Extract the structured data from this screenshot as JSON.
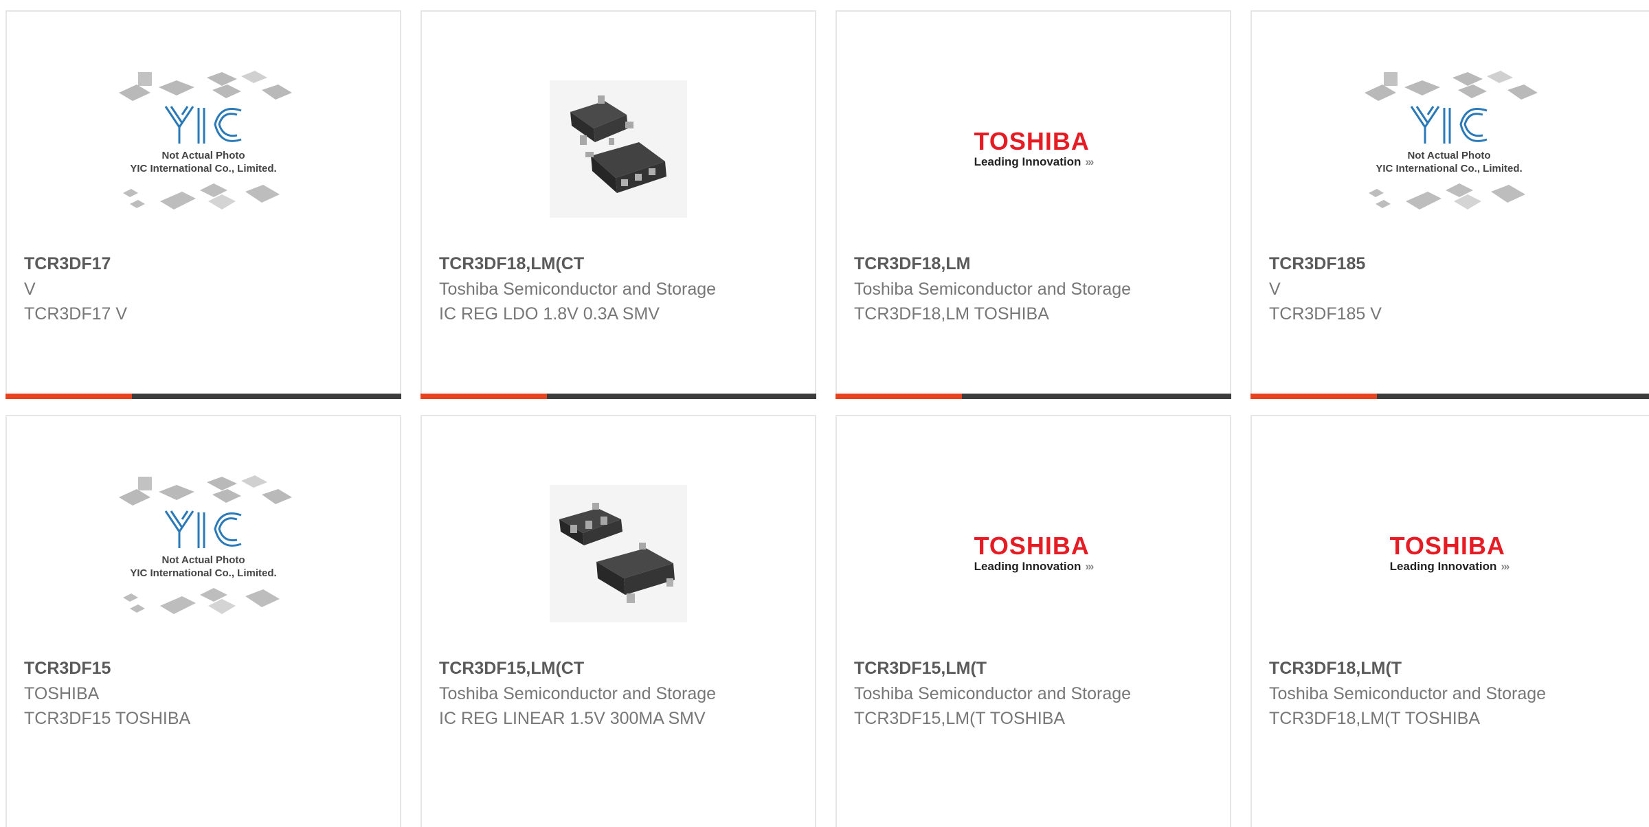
{
  "placeholder": {
    "line1": "Not Actual Photo",
    "line2": "YIC International Co., Limited.",
    "mark": "YIC"
  },
  "toshiba_logo": {
    "brand": "TOSHIBA",
    "tagline": "Leading Innovation",
    "arrows": "›››"
  },
  "colors": {
    "accent": "#e8431f",
    "bar": "#3c3c3c",
    "brand_red": "#e51c23",
    "yic_blue": "#2a79b8"
  },
  "products": [
    {
      "part_number": "TCR3DF17",
      "manufacturer": "V",
      "description": "TCR3DF17 V",
      "image": "placeholder"
    },
    {
      "part_number": "TCR3DF18,LM(CT",
      "manufacturer": "Toshiba Semiconductor and Storage",
      "description": "IC REG LDO 1.8V 0.3A SMV",
      "image": "chip-photo"
    },
    {
      "part_number": "TCR3DF18,LM",
      "manufacturer": "Toshiba Semiconductor and Storage",
      "description": "TCR3DF18,LM TOSHIBA",
      "image": "toshiba-logo"
    },
    {
      "part_number": "TCR3DF185",
      "manufacturer": "V",
      "description": "TCR3DF185 V",
      "image": "placeholder"
    },
    {
      "part_number": "TCR3DF15",
      "manufacturer": "TOSHIBA",
      "description": "TCR3DF15 TOSHIBA",
      "image": "placeholder"
    },
    {
      "part_number": "TCR3DF15,LM(CT",
      "manufacturer": "Toshiba Semiconductor and Storage",
      "description": "IC REG LINEAR 1.5V 300MA SMV",
      "image": "chip-photo"
    },
    {
      "part_number": "TCR3DF15,LM(T",
      "manufacturer": "Toshiba Semiconductor and Storage",
      "description": "TCR3DF15,LM(T TOSHIBA",
      "image": "toshiba-logo"
    },
    {
      "part_number": "TCR3DF18,LM(T",
      "manufacturer": "Toshiba Semiconductor and Storage",
      "description": "TCR3DF18,LM(T TOSHIBA",
      "image": "toshiba-logo"
    }
  ]
}
